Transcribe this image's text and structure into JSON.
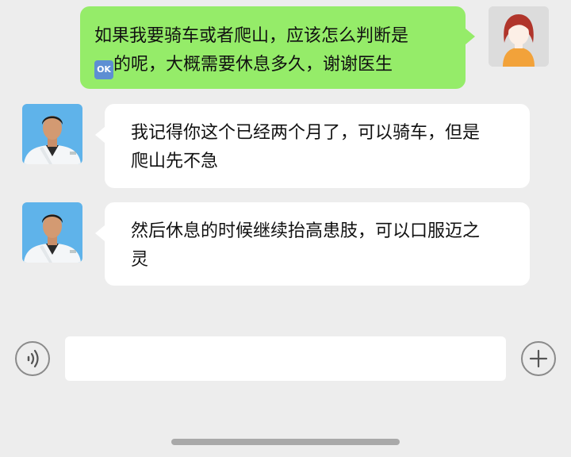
{
  "messages": [
    {
      "sender": "user",
      "line1": "如果我要骑车或者爬山，应该怎么判断是",
      "emoji": "OK",
      "line2": "的呢，大概需要休息多久，谢谢医生"
    },
    {
      "sender": "doctor",
      "line1": "我记得你这个已经两个月了，可以骑车，但是",
      "line2": "爬山先不急"
    },
    {
      "sender": "doctor",
      "line1": "然后休息的时候继续抬高患肢，可以口服迈之",
      "line2": "灵"
    }
  ],
  "input": {
    "placeholder": ""
  },
  "icons": {
    "voice": "voice-icon",
    "add": "plus-icon",
    "user_avatar": "user-avatar",
    "doctor_avatar": "doctor-avatar"
  },
  "colors": {
    "background": "#ededed",
    "my_bubble": "#95ec69",
    "their_bubble": "#ffffff"
  }
}
